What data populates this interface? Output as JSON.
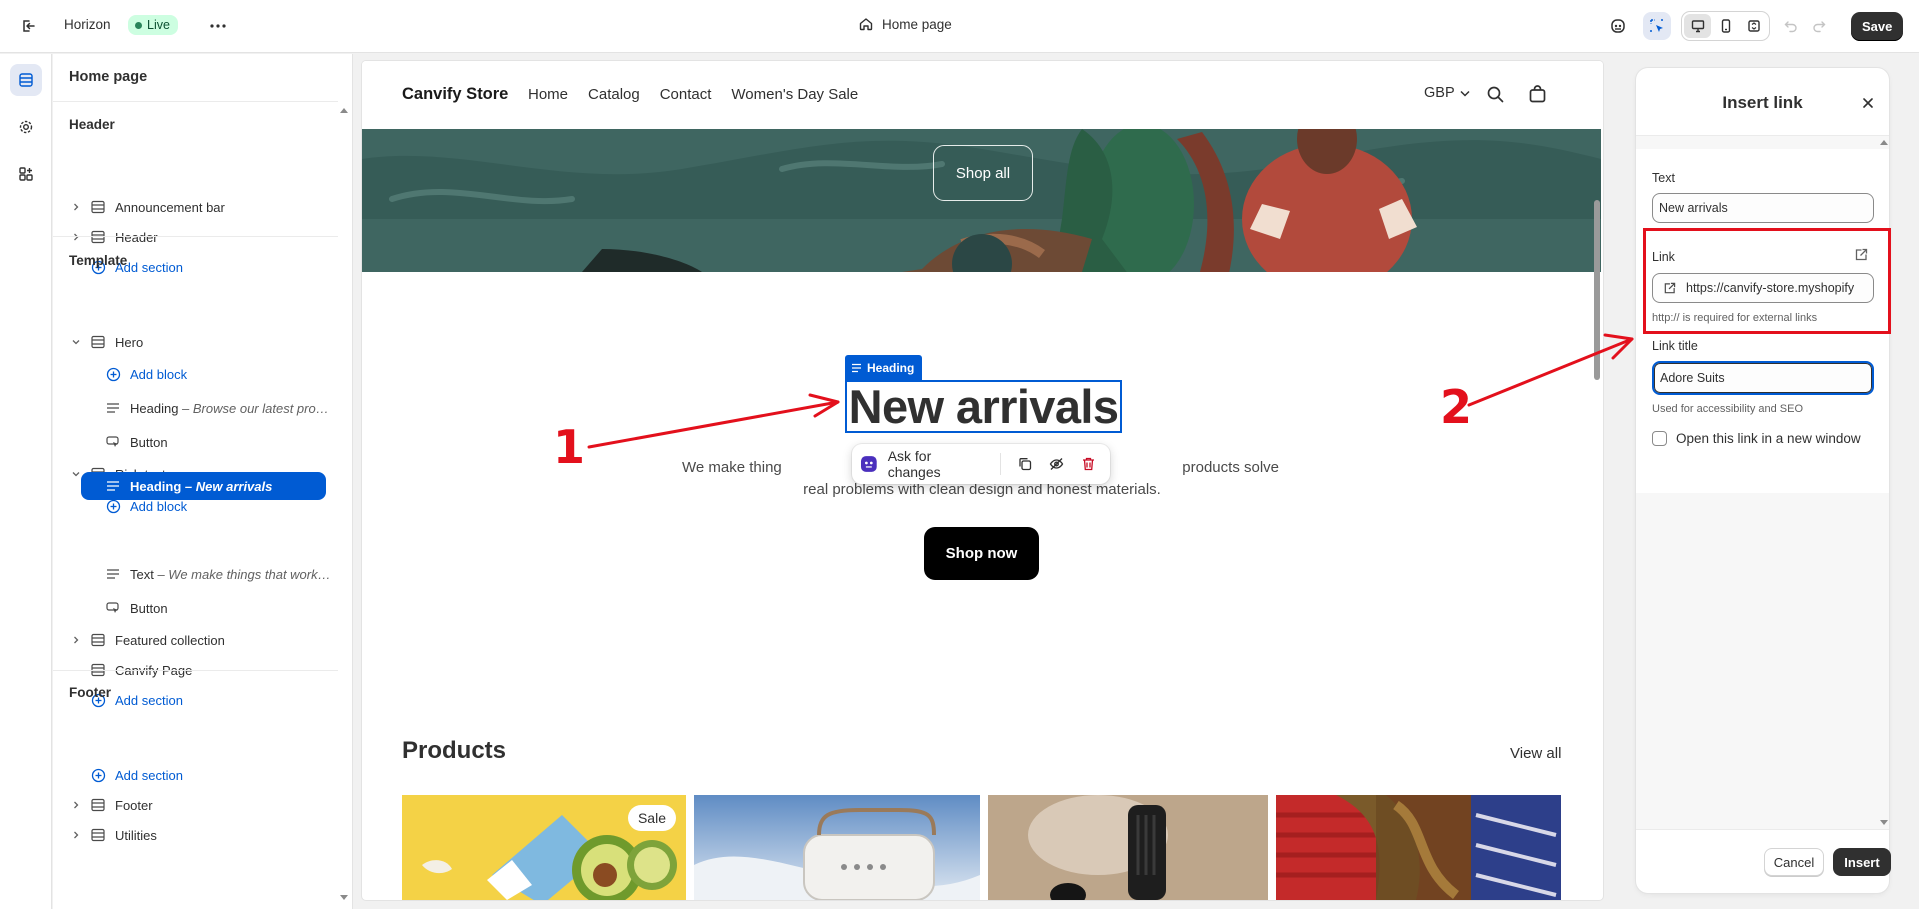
{
  "topbar": {
    "theme_name": "Horizon",
    "live_label": "Live",
    "page_selector": "Home page",
    "save_label": "Save"
  },
  "sidebar": {
    "title": "Home page",
    "header_group": "Header",
    "header_items": [
      "Announcement bar",
      "Header"
    ],
    "add_section": "Add section",
    "template_group": "Template",
    "hero_label": "Hero",
    "add_block": "Add block",
    "hero_heading": "Heading",
    "hero_heading_sub": " – Browse our latest pro…",
    "hero_button": "Button",
    "rich_text_label": "Rich text",
    "rich_heading": "Heading",
    "rich_heading_sub": " – New arrivals",
    "rich_text": "Text",
    "rich_text_sub": " – We make things that work…",
    "rich_button": "Button",
    "featured_collection": "Featured collection",
    "canvify_page": "Canvify Page",
    "footer_group": "Footer",
    "footer_items": [
      "Footer",
      "Utilities"
    ]
  },
  "store": {
    "brand": "Canvify Store",
    "nav": [
      "Home",
      "Catalog",
      "Contact",
      "Women's Day Sale"
    ],
    "currency": "GBP",
    "hero_button": "Shop all",
    "heading_tag": "Heading",
    "heading": "New arrivals",
    "paragraph_line1_a": "We make thing",
    "paragraph_line1_b": "products solve",
    "paragraph_line2": "real problems with clean design and honest materials.",
    "ask_changes": "Ask for changes",
    "shop_now": "Shop now",
    "products_title": "Products",
    "view_all": "View all",
    "sale_badge": "Sale"
  },
  "insert_link": {
    "title": "Insert link",
    "text_label": "Text",
    "text_value": "New arrivals",
    "link_label": "Link",
    "link_value": "https://canvify-store.myshopify",
    "link_help": "http:// is required for external links",
    "link_title_label": "Link title",
    "link_title_value": "Adore Suits",
    "link_title_help": "Used for accessibility and SEO",
    "new_window_label": "Open this link in a new window",
    "new_window_checked": false,
    "cancel_label": "Cancel",
    "insert_label": "Insert"
  },
  "annotations": {
    "step1": "1",
    "step2": "2",
    "color": "#e3101c"
  },
  "colors": {
    "accent": "#005bd3",
    "live_badge": "#cdfee1",
    "hero_bg": "#3f6661",
    "primary_button": "#303030"
  }
}
